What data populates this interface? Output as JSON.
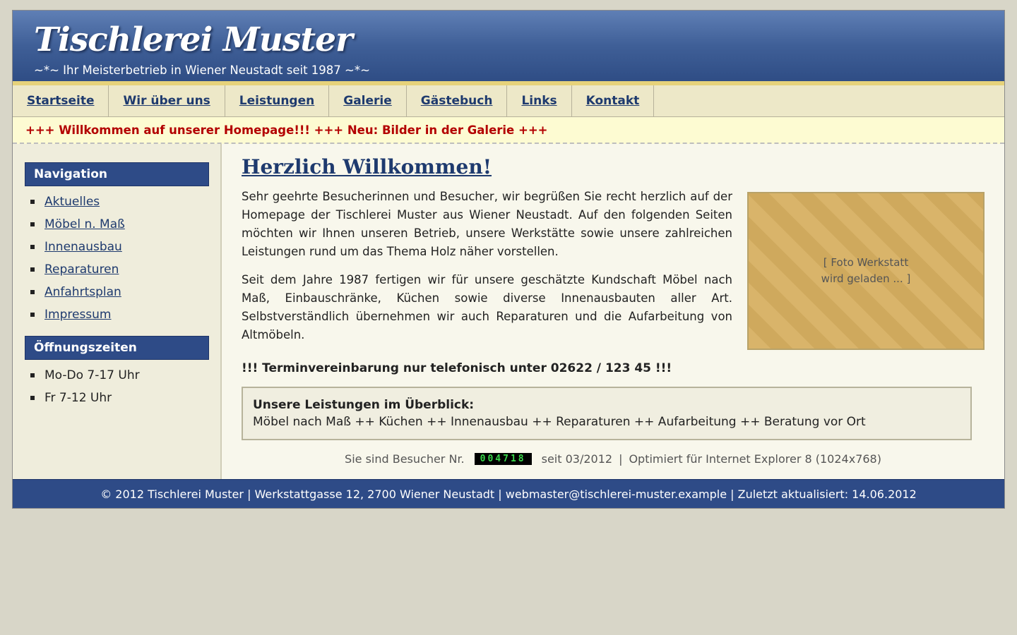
{
  "header": {
    "title": "Tischlerei Muster",
    "slogan": "~*~ Ihr Meisterbetrieb in Wiener Neustadt seit 1987 ~*~"
  },
  "topnav": [
    "Startseite",
    "Wir über uns",
    "Leistungen",
    "Galerie",
    "Gästebuch",
    "Links",
    "Kontakt"
  ],
  "ticker": "+++ Willkommen auf unserer Homepage!!! +++ Neu: Bilder in der Galerie +++",
  "sidebar": {
    "navigation_title": "Navigation",
    "navigation_items": [
      "Aktuelles",
      "Möbel n. Maß",
      "Innenausbau",
      "Reparaturen",
      "Anfahrtsplan",
      "Impressum"
    ],
    "hours_title": "Öffnungszeiten",
    "hours_items": [
      "Mo-Do 7-17 Uhr",
      "Fr 7-12 Uhr"
    ]
  },
  "main": {
    "title": "Herzlich Willkommen!",
    "paragraph1": "Sehr geehrte Besucherinnen und Besucher, wir begrüßen Sie recht herzlich auf der Homepage der Tischlerei Muster aus Wiener Neustadt. Auf den folgenden Seiten möchten wir Ihnen unseren Betrieb, unsere Werkstätte sowie unsere zahlreichen Leistungen rund um das Thema Holz näher vorstellen.",
    "paragraph2": "Seit dem Jahre 1987 fertigen wir für unsere geschätzte Kundschaft Möbel nach Maß, Einbauschränke, Küchen sowie diverse Innenausbauten aller Art. Selbstverständlich übernehmen wir auch Reparaturen und die Aufarbeitung von Altmöbeln.",
    "photo_placeholder_line1": "[ Foto Werkstatt",
    "photo_placeholder_line2": "wird geladen ... ]",
    "appointment": "!!! Terminvereinbarung nur telefonisch unter 02622 / 123 45 !!!",
    "overview_title": "Unsere Leistungen im Überblick:",
    "overview_text": "Möbel nach Maß ++ Küchen ++ Innenausbau ++ Reparaturen ++ Aufarbeitung ++ Beratung vor Ort",
    "counter_prefix": "Sie sind Besucher Nr.",
    "counter_value": "004718",
    "counter_since": "seit 03/2012",
    "counter_separator": "|",
    "optimized": "Optimiert für Internet Explorer 8 (1024x768)"
  },
  "footer": "© 2012 Tischlerei Muster | Werkstattgasse 12, 2700 Wiener Neustadt | webmaster@tischlerei-muster.example | Zuletzt aktualisiert: 14.06.2012",
  "colors": {
    "header_blue": "#3f5f97",
    "accent_gold": "#e6d27a",
    "ticker_red": "#b30000",
    "link_blue": "#1e3a6e",
    "counter_green": "#39d64a"
  }
}
